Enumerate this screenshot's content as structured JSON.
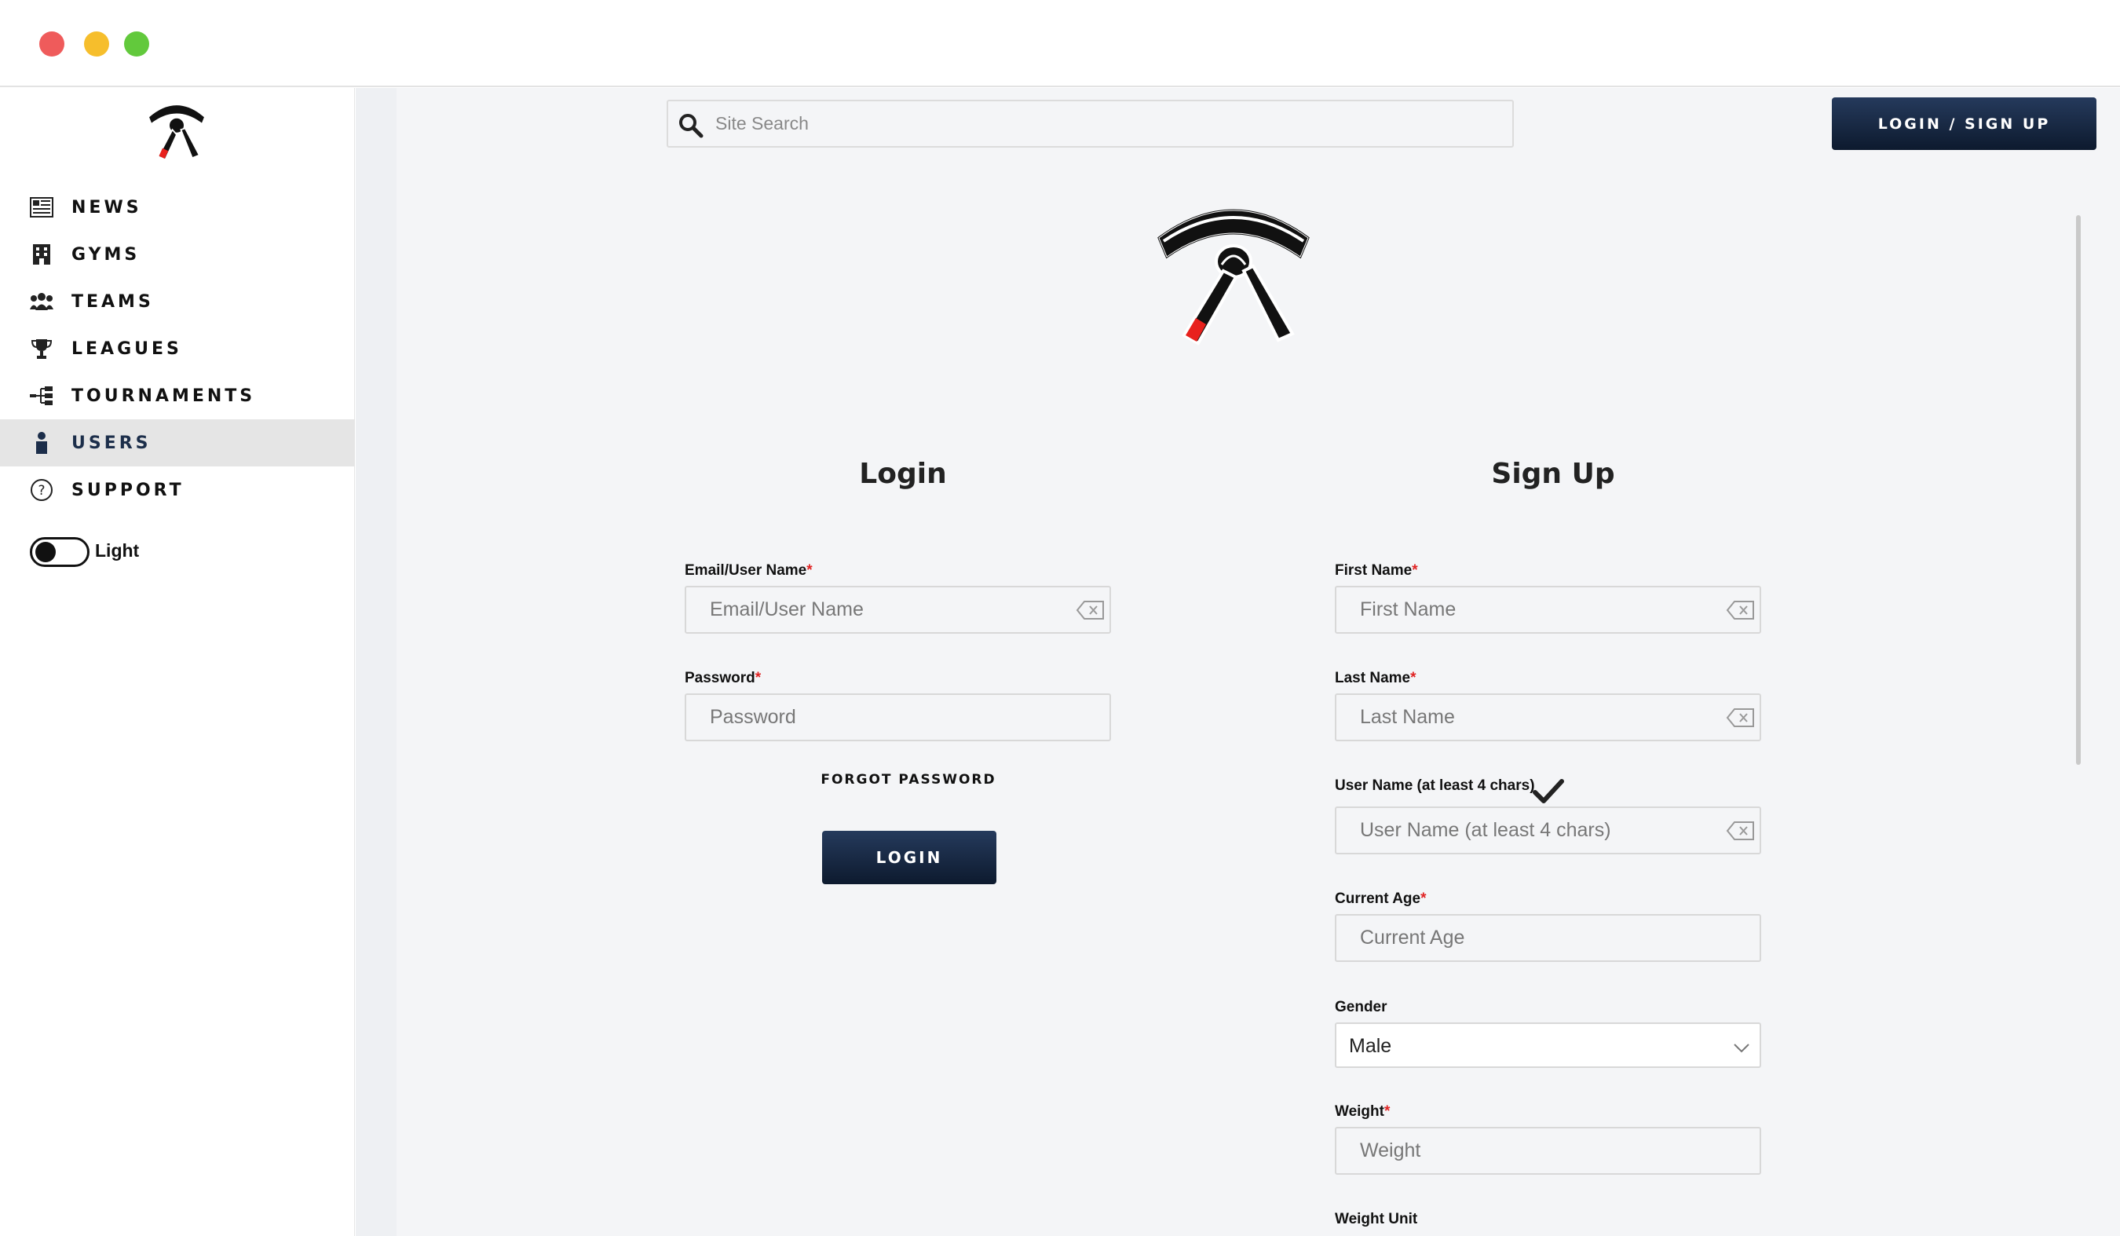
{
  "window": {
    "controls": [
      "close",
      "minimize",
      "maximize"
    ]
  },
  "sidebar": {
    "logo": "belt-logo",
    "items": [
      {
        "label": "NEWS",
        "icon": "news-icon",
        "active": false
      },
      {
        "label": "GYMS",
        "icon": "building-icon",
        "active": false
      },
      {
        "label": "TEAMS",
        "icon": "users-group-icon",
        "active": false
      },
      {
        "label": "LEAGUES",
        "icon": "trophy-icon",
        "active": false
      },
      {
        "label": "TOURNAMENTS",
        "icon": "bracket-icon",
        "active": false
      },
      {
        "label": "USERS",
        "icon": "user-icon",
        "active": true
      },
      {
        "label": "SUPPORT",
        "icon": "question-circle-icon",
        "active": false
      }
    ],
    "theme_toggle": {
      "label": "Light",
      "on": false
    }
  },
  "header": {
    "search": {
      "placeholder": "Site Search"
    },
    "login_signup_label": "LOGIN / SIGN UP"
  },
  "login": {
    "title": "Login",
    "email_label": "Email/User Name",
    "email_placeholder": "Email/User Name",
    "password_label": "Password",
    "password_placeholder": "Password",
    "forgot_label": "FORGOT PASSWORD",
    "submit_label": "LOGIN"
  },
  "signup": {
    "title": "Sign Up",
    "first_name_label": "First Name",
    "first_name_placeholder": "First Name",
    "last_name_label": "Last Name",
    "last_name_placeholder": "Last Name",
    "username_label": "User Name (at least 4 chars)",
    "username_placeholder": "User Name (at least 4 chars)",
    "age_label": "Current Age",
    "age_placeholder": "Current Age",
    "gender_label": "Gender",
    "gender_value": "Male",
    "weight_label": "Weight",
    "weight_placeholder": "Weight",
    "weight_unit_label": "Weight Unit"
  },
  "required_marker": "*",
  "colors": {
    "accent": "#1c2e4a",
    "required": "#e02424",
    "belt_red": "#e8211d"
  }
}
